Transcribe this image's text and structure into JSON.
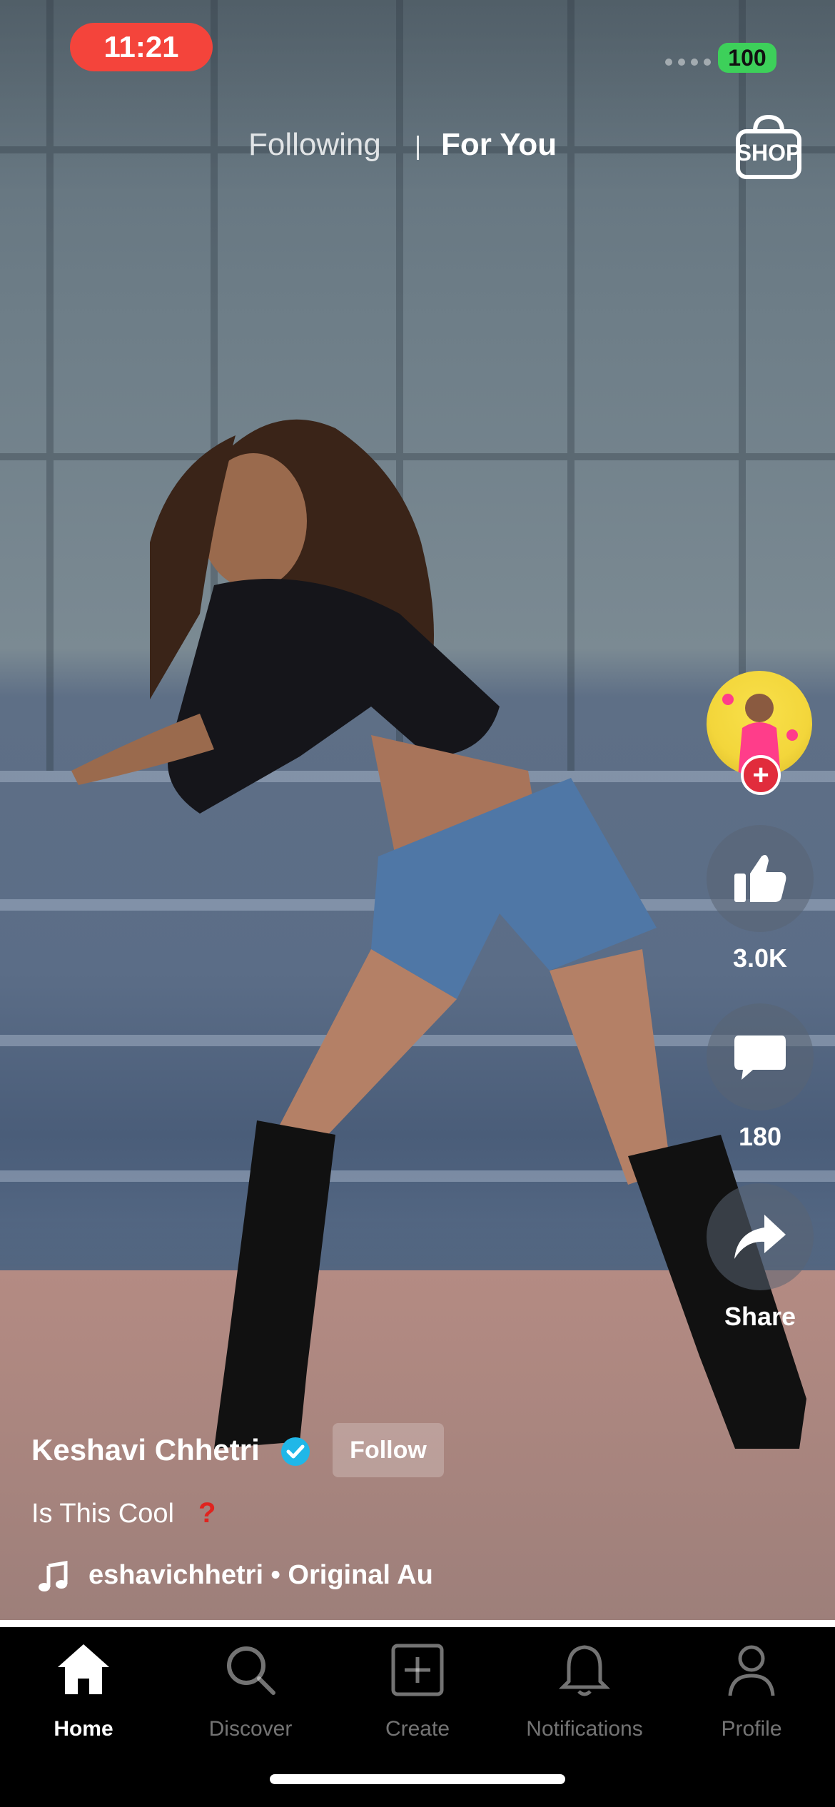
{
  "status_bar": {
    "time": "11:21",
    "battery": "100"
  },
  "top_tabs": {
    "following": "Following",
    "for_you": "For You",
    "shop": "SHOP"
  },
  "right_rail": {
    "likes": "3.0K",
    "comments": "180",
    "share": "Share"
  },
  "post": {
    "author": "Keshavi Chhetri",
    "follow": "Follow",
    "caption": "Is This Cool",
    "caption_mark": "?",
    "music": "eshavichhetri • Original Au"
  },
  "bottom_nav": {
    "home": "Home",
    "discover": "Discover",
    "create": "Create",
    "notifications": "Notifications",
    "profile": "Profile"
  },
  "colors": {
    "time_pill": "#f4443b",
    "battery": "#3dd05a",
    "verified": "#20b7e8",
    "plus": "#e12c3c"
  }
}
